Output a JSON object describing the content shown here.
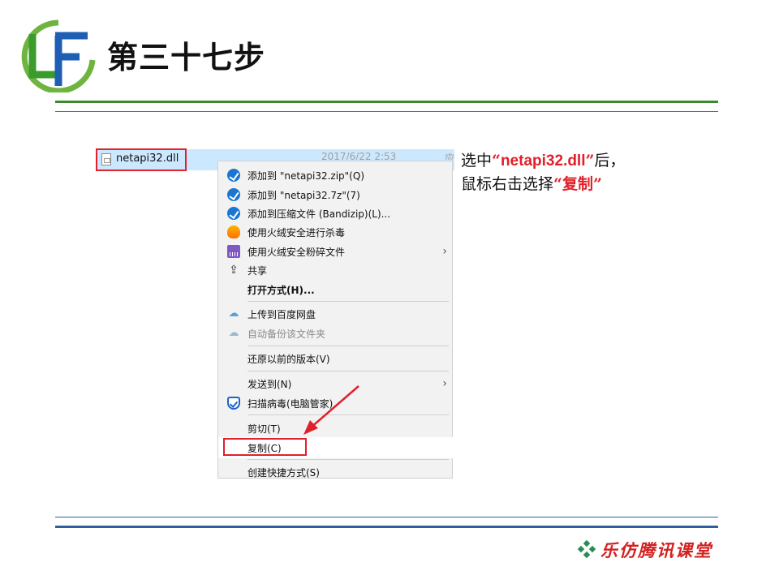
{
  "slide": {
    "logo_text": "LF",
    "title": "第三十七步"
  },
  "file_row": {
    "name": "netapi32.dll",
    "date_partial": "2017/6/22 2:53",
    "extra_partial": "应"
  },
  "context_menu": {
    "items": [
      {
        "label": "添加到 \"netapi32.zip\"(Q)",
        "icon": "bandizip-icon"
      },
      {
        "label": "添加到 \"netapi32.7z\"(7)",
        "icon": "bandizip-icon"
      },
      {
        "label": "添加到压缩文件 (Bandizip)(L)...",
        "icon": "bandizip-icon"
      },
      {
        "label": "使用火绒安全进行杀毒",
        "icon": "huorong-icon"
      },
      {
        "label": "使用火绒安全粉碎文件",
        "icon": "shredder-icon"
      },
      {
        "label": "共享",
        "icon": "share-icon"
      },
      {
        "label": "打开方式(H)...",
        "icon": ""
      },
      {
        "label": "上传到百度网盘",
        "icon": "baidu-cloud-icon"
      },
      {
        "label": "自动备份该文件夹",
        "icon": "baidu-cloud-icon"
      },
      {
        "label": "还原以前的版本(V)",
        "icon": ""
      },
      {
        "label": "发送到(N)",
        "icon": ""
      },
      {
        "label": "扫描病毒(电脑管家)",
        "icon": "shield-icon"
      },
      {
        "label": "剪切(T)",
        "icon": ""
      },
      {
        "label": "复制(C)",
        "icon": ""
      },
      {
        "label": "创建快捷方式(S)",
        "icon": ""
      }
    ]
  },
  "annotation": {
    "line1_prefix": "选中",
    "quote_open": "“",
    "filename": "netapi32.dll",
    "quote_close": "”",
    "line1_suffix": "后，",
    "line2_prefix": "鼠标右击选择",
    "action": "“复制”"
  },
  "footer": {
    "brand": "乐仿腾讯课堂"
  },
  "colors": {
    "accent_red": "#e0202a",
    "green_rule": "#3c8a2e",
    "blue_rule": "#2f5f9e",
    "selection_blue": "#cce8ff"
  }
}
